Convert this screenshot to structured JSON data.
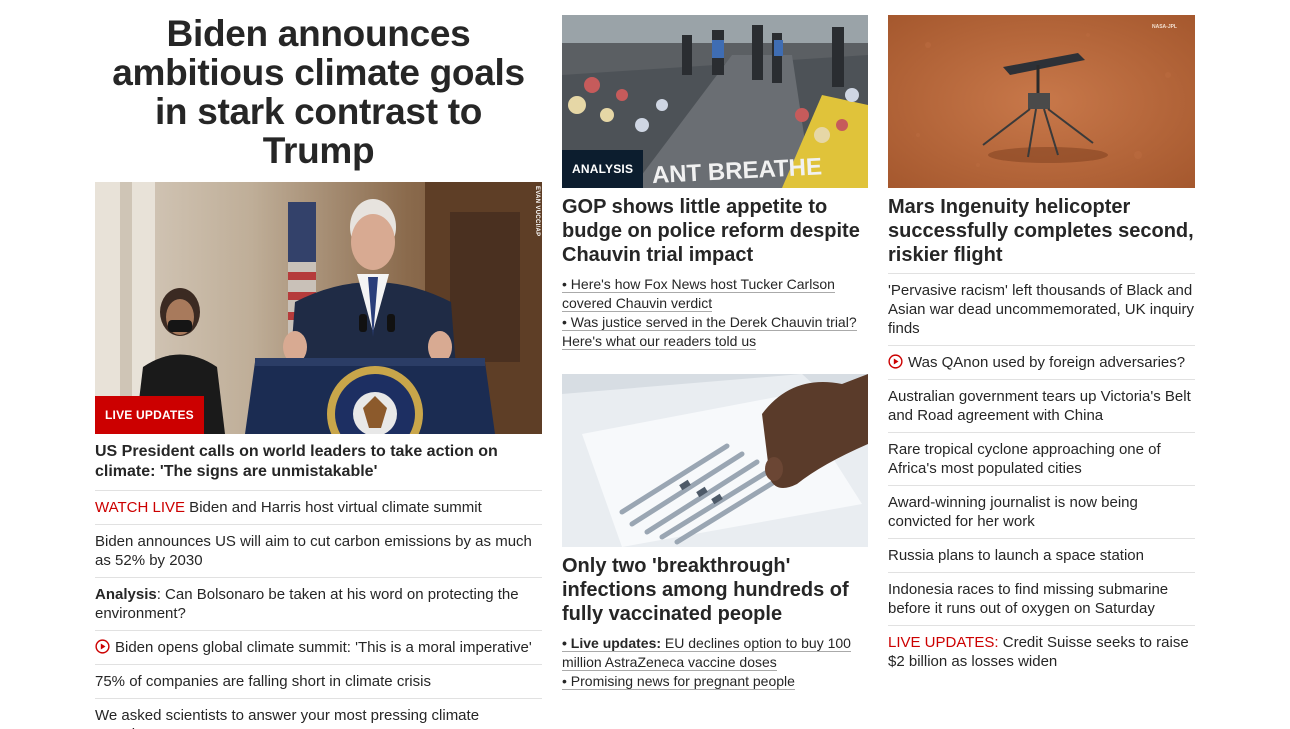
{
  "left": {
    "hero_title": "Biden announces ambitious climate goals in stark contrast to Trump",
    "image_credit": "EVAN VUCCI/AP",
    "badge": "LIVE UPDATES",
    "lead_headline": "US President calls on world leaders to take action on climate: 'The signs are unmistakable'",
    "items": [
      {
        "prefix": "WATCH LIVE",
        "text": " Biden and Harris host virtual climate summit"
      },
      {
        "text": "Biden announces US will aim to cut carbon emissions by as much as 52% by 2030"
      },
      {
        "prefix": "Analysis",
        "text": ": Can Bolsonaro be taken at his word on protecting the environment?"
      },
      {
        "icon": "play-icon",
        "text": "Biden opens global climate summit: 'This is a moral imperative'"
      },
      {
        "text": "75% of companies are falling short in climate crisis"
      },
      {
        "text": "We asked scientists to answer your most pressing climate questions"
      }
    ]
  },
  "mid": {
    "story1": {
      "badge": "ANALYSIS",
      "image_text": "ANT BREATHE",
      "headline": "GOP shows little appetite to budge on police reform despite Chauvin trial impact",
      "bullets": [
        {
          "text": "• Here's how Fox News host Tucker Carlson covered Chauvin verdict"
        },
        {
          "text": "• Was justice served in the Derek Chauvin trial? Here's what our readers told us"
        }
      ]
    },
    "story2": {
      "headline": "Only two 'breakthrough' infections among hundreds of fully vaccinated people",
      "bullets": [
        {
          "lead": "• Live updates:",
          "text": " EU declines option to buy 100 million AstraZeneca vaccine doses"
        },
        {
          "text": "• Promising news for pregnant people"
        }
      ]
    }
  },
  "right": {
    "image_credit": "NASA-JPL",
    "headline": "Mars Ingenuity helicopter successfully completes second, riskier flight",
    "items": [
      {
        "text": "'Pervasive racism' left thousands of Black and Asian war dead uncommemorated, UK inquiry finds"
      },
      {
        "icon": "play-icon",
        "text": "Was QAnon used by foreign adversaries?"
      },
      {
        "text": "Australian government tears up Victoria's Belt and Road agreement with China"
      },
      {
        "text": "Rare tropical cyclone approaching one of Africa's most populated cities"
      },
      {
        "text": "Award-winning journalist is now being convicted for her work"
      },
      {
        "text": "Russia plans to launch a space station"
      },
      {
        "text": "Indonesia races to find missing submarine before it runs out of oxygen on Saturday"
      },
      {
        "prefix": "LIVE UPDATES:",
        "text": " Credit Suisse seeks to raise $2 billion as losses widen"
      }
    ]
  },
  "colors": {
    "accent_red": "#cc0000",
    "badge_dark": "#0c1d2e",
    "text": "#262626",
    "divider": "#e1e1e1"
  }
}
